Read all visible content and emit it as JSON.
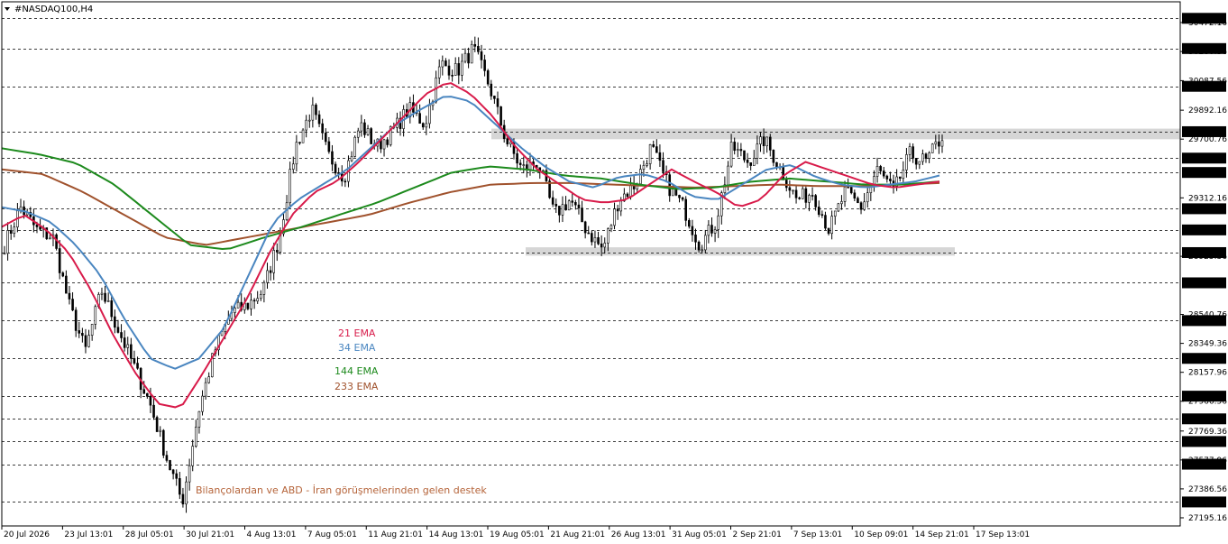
{
  "window": {
    "symbol_title": "#NASDAQ100,H4",
    "menu_icon": "triangle-down-icon"
  },
  "colors": {
    "background": "#ffffff",
    "candle": "#000000",
    "grid": "#000000",
    "ema21": "#d81b4a",
    "ema34": "#4a86c0",
    "ema144": "#1d8a1d",
    "ema233": "#a0522d",
    "zone": "#d6d6d6",
    "annotation": "#b5643a",
    "price_tag_bg": "#000000",
    "price_tag_text": "#ffffff"
  },
  "chart_data": {
    "type": "candlestick",
    "symbol": "#NASDAQ100",
    "timeframe": "H4",
    "y_range": [
      27150,
      30580
    ],
    "x_tick_labels": [
      "20 Jul 2026",
      "23 Jul 13:01",
      "28 Jul 05:01",
      "30 Jul 21:01",
      "4 Aug 13:01",
      "7 Aug 05:01",
      "11 Aug 21:01",
      "14 Aug 13:01",
      "19 Aug 05:01",
      "21 Aug 21:01",
      "26 Aug 13:01",
      "31 Aug 05:01",
      "2 Sep 21:01",
      "7 Sep 13:01",
      "10 Sep 09:01",
      "14 Sep 21:01",
      "17 Sep 13:01"
    ],
    "highlighted_levels": [
      30500,
      30300,
      30050,
      29750,
      29575,
      29480,
      29240,
      29100,
      28950,
      28750,
      28500,
      28250,
      28000,
      27850,
      27700,
      27550,
      27300
    ],
    "minor_levels": [
      30472.16,
      30280.36,
      30087.56,
      29892.16,
      29700.76,
      29312.16,
      28925.36,
      28540.76,
      28349.36,
      28157.96,
      27966.56,
      27769.36,
      27577.96,
      27386.56,
      27195.16
    ],
    "current_price_label": "29700.76",
    "resistance_zone": {
      "low": 29700,
      "high": 29770
    },
    "support_zone": {
      "low": 28930,
      "high": 28985
    },
    "legend": [
      {
        "name": "21 EMA",
        "color": "#d81b4a"
      },
      {
        "name": "34 EMA",
        "color": "#4a86c0"
      },
      {
        "name": "144 EMA",
        "color": "#1d8a1d"
      },
      {
        "name": "233 EMA",
        "color": "#a0522d"
      }
    ],
    "annotation": "Bilançolardan ve ABD - İran görüşmelerinden gelen destek",
    "close_path": [
      29000,
      29250,
      29100,
      29050,
      28600,
      28300,
      28700,
      28450,
      28200,
      27950,
      27600,
      27300,
      27900,
      28300,
      28550,
      28600,
      28700,
      29050,
      29650,
      29900,
      29600,
      29450,
      29800,
      29650,
      29750,
      29900,
      29800,
      30200,
      30150,
      30300,
      30050,
      29700,
      29500,
      29550,
      29200,
      29300,
      29100,
      28970,
      29300,
      29400,
      29650,
      29400,
      29250,
      29000,
      29150,
      29650,
      29550,
      29700,
      29500,
      29300,
      29350,
      29100,
      29350,
      29250,
      29500,
      29350,
      29600,
      29550,
      29720
    ],
    "ema21_path": [
      29120,
      29200,
      29100,
      28950,
      28700,
      28400,
      28150,
      27950,
      27920,
      28150,
      28400,
      28650,
      28950,
      29200,
      29350,
      29420,
      29550,
      29700,
      29850,
      30000,
      30080,
      30000,
      29850,
      29650,
      29500,
      29400,
      29300,
      29280,
      29300,
      29400,
      29500,
      29420,
      29350,
      29250,
      29300,
      29460,
      29550,
      29500,
      29450,
      29400,
      29380,
      29400,
      29420
    ],
    "ema34_path": [
      29250,
      29220,
      29150,
      29000,
      28800,
      28500,
      28250,
      28180,
      28250,
      28450,
      28800,
      29150,
      29300,
      29400,
      29500,
      29650,
      29800,
      29900,
      29990,
      29950,
      29800,
      29650,
      29520,
      29420,
      29380,
      29450,
      29470,
      29420,
      29320,
      29300,
      29400,
      29500,
      29530,
      29450,
      29400,
      29380,
      29400,
      29420,
      29460
    ],
    "ema144_path": [
      29640,
      29600,
      29540,
      29400,
      29200,
      29000,
      28970,
      29050,
      29120,
      29200,
      29280,
      29380,
      29480,
      29520,
      29500,
      29460,
      29440,
      29400,
      29370,
      29380,
      29420,
      29440,
      29420,
      29400,
      29400,
      29420
    ],
    "ema233_path": [
      29500,
      29470,
      29350,
      29200,
      29050,
      29000,
      29050,
      29100,
      29150,
      29200,
      29280,
      29350,
      29400,
      29410,
      29410,
      29400,
      29390,
      29380,
      29390,
      29400,
      29390,
      29390,
      29400,
      29410
    ]
  }
}
